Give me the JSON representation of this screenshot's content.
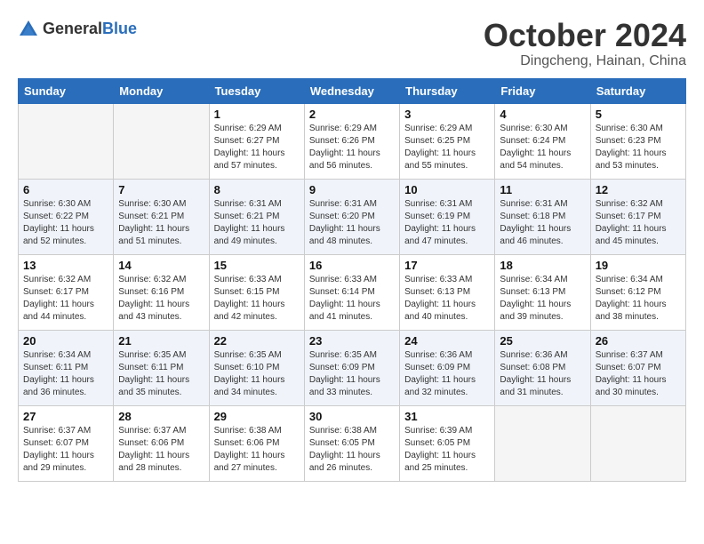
{
  "header": {
    "logo_general": "General",
    "logo_blue": "Blue",
    "month": "October 2024",
    "location": "Dingcheng, Hainan, China"
  },
  "weekdays": [
    "Sunday",
    "Monday",
    "Tuesday",
    "Wednesday",
    "Thursday",
    "Friday",
    "Saturday"
  ],
  "weeks": [
    [
      {
        "day": "",
        "sunrise": "",
        "sunset": "",
        "daylight": ""
      },
      {
        "day": "",
        "sunrise": "",
        "sunset": "",
        "daylight": ""
      },
      {
        "day": "1",
        "sunrise": "Sunrise: 6:29 AM",
        "sunset": "Sunset: 6:27 PM",
        "daylight": "Daylight: 11 hours and 57 minutes."
      },
      {
        "day": "2",
        "sunrise": "Sunrise: 6:29 AM",
        "sunset": "Sunset: 6:26 PM",
        "daylight": "Daylight: 11 hours and 56 minutes."
      },
      {
        "day": "3",
        "sunrise": "Sunrise: 6:29 AM",
        "sunset": "Sunset: 6:25 PM",
        "daylight": "Daylight: 11 hours and 55 minutes."
      },
      {
        "day": "4",
        "sunrise": "Sunrise: 6:30 AM",
        "sunset": "Sunset: 6:24 PM",
        "daylight": "Daylight: 11 hours and 54 minutes."
      },
      {
        "day": "5",
        "sunrise": "Sunrise: 6:30 AM",
        "sunset": "Sunset: 6:23 PM",
        "daylight": "Daylight: 11 hours and 53 minutes."
      }
    ],
    [
      {
        "day": "6",
        "sunrise": "Sunrise: 6:30 AM",
        "sunset": "Sunset: 6:22 PM",
        "daylight": "Daylight: 11 hours and 52 minutes."
      },
      {
        "day": "7",
        "sunrise": "Sunrise: 6:30 AM",
        "sunset": "Sunset: 6:21 PM",
        "daylight": "Daylight: 11 hours and 51 minutes."
      },
      {
        "day": "8",
        "sunrise": "Sunrise: 6:31 AM",
        "sunset": "Sunset: 6:21 PM",
        "daylight": "Daylight: 11 hours and 49 minutes."
      },
      {
        "day": "9",
        "sunrise": "Sunrise: 6:31 AM",
        "sunset": "Sunset: 6:20 PM",
        "daylight": "Daylight: 11 hours and 48 minutes."
      },
      {
        "day": "10",
        "sunrise": "Sunrise: 6:31 AM",
        "sunset": "Sunset: 6:19 PM",
        "daylight": "Daylight: 11 hours and 47 minutes."
      },
      {
        "day": "11",
        "sunrise": "Sunrise: 6:31 AM",
        "sunset": "Sunset: 6:18 PM",
        "daylight": "Daylight: 11 hours and 46 minutes."
      },
      {
        "day": "12",
        "sunrise": "Sunrise: 6:32 AM",
        "sunset": "Sunset: 6:17 PM",
        "daylight": "Daylight: 11 hours and 45 minutes."
      }
    ],
    [
      {
        "day": "13",
        "sunrise": "Sunrise: 6:32 AM",
        "sunset": "Sunset: 6:17 PM",
        "daylight": "Daylight: 11 hours and 44 minutes."
      },
      {
        "day": "14",
        "sunrise": "Sunrise: 6:32 AM",
        "sunset": "Sunset: 6:16 PM",
        "daylight": "Daylight: 11 hours and 43 minutes."
      },
      {
        "day": "15",
        "sunrise": "Sunrise: 6:33 AM",
        "sunset": "Sunset: 6:15 PM",
        "daylight": "Daylight: 11 hours and 42 minutes."
      },
      {
        "day": "16",
        "sunrise": "Sunrise: 6:33 AM",
        "sunset": "Sunset: 6:14 PM",
        "daylight": "Daylight: 11 hours and 41 minutes."
      },
      {
        "day": "17",
        "sunrise": "Sunrise: 6:33 AM",
        "sunset": "Sunset: 6:13 PM",
        "daylight": "Daylight: 11 hours and 40 minutes."
      },
      {
        "day": "18",
        "sunrise": "Sunrise: 6:34 AM",
        "sunset": "Sunset: 6:13 PM",
        "daylight": "Daylight: 11 hours and 39 minutes."
      },
      {
        "day": "19",
        "sunrise": "Sunrise: 6:34 AM",
        "sunset": "Sunset: 6:12 PM",
        "daylight": "Daylight: 11 hours and 38 minutes."
      }
    ],
    [
      {
        "day": "20",
        "sunrise": "Sunrise: 6:34 AM",
        "sunset": "Sunset: 6:11 PM",
        "daylight": "Daylight: 11 hours and 36 minutes."
      },
      {
        "day": "21",
        "sunrise": "Sunrise: 6:35 AM",
        "sunset": "Sunset: 6:11 PM",
        "daylight": "Daylight: 11 hours and 35 minutes."
      },
      {
        "day": "22",
        "sunrise": "Sunrise: 6:35 AM",
        "sunset": "Sunset: 6:10 PM",
        "daylight": "Daylight: 11 hours and 34 minutes."
      },
      {
        "day": "23",
        "sunrise": "Sunrise: 6:35 AM",
        "sunset": "Sunset: 6:09 PM",
        "daylight": "Daylight: 11 hours and 33 minutes."
      },
      {
        "day": "24",
        "sunrise": "Sunrise: 6:36 AM",
        "sunset": "Sunset: 6:09 PM",
        "daylight": "Daylight: 11 hours and 32 minutes."
      },
      {
        "day": "25",
        "sunrise": "Sunrise: 6:36 AM",
        "sunset": "Sunset: 6:08 PM",
        "daylight": "Daylight: 11 hours and 31 minutes."
      },
      {
        "day": "26",
        "sunrise": "Sunrise: 6:37 AM",
        "sunset": "Sunset: 6:07 PM",
        "daylight": "Daylight: 11 hours and 30 minutes."
      }
    ],
    [
      {
        "day": "27",
        "sunrise": "Sunrise: 6:37 AM",
        "sunset": "Sunset: 6:07 PM",
        "daylight": "Daylight: 11 hours and 29 minutes."
      },
      {
        "day": "28",
        "sunrise": "Sunrise: 6:37 AM",
        "sunset": "Sunset: 6:06 PM",
        "daylight": "Daylight: 11 hours and 28 minutes."
      },
      {
        "day": "29",
        "sunrise": "Sunrise: 6:38 AM",
        "sunset": "Sunset: 6:06 PM",
        "daylight": "Daylight: 11 hours and 27 minutes."
      },
      {
        "day": "30",
        "sunrise": "Sunrise: 6:38 AM",
        "sunset": "Sunset: 6:05 PM",
        "daylight": "Daylight: 11 hours and 26 minutes."
      },
      {
        "day": "31",
        "sunrise": "Sunrise: 6:39 AM",
        "sunset": "Sunset: 6:05 PM",
        "daylight": "Daylight: 11 hours and 25 minutes."
      },
      {
        "day": "",
        "sunrise": "",
        "sunset": "",
        "daylight": ""
      },
      {
        "day": "",
        "sunrise": "",
        "sunset": "",
        "daylight": ""
      }
    ]
  ]
}
